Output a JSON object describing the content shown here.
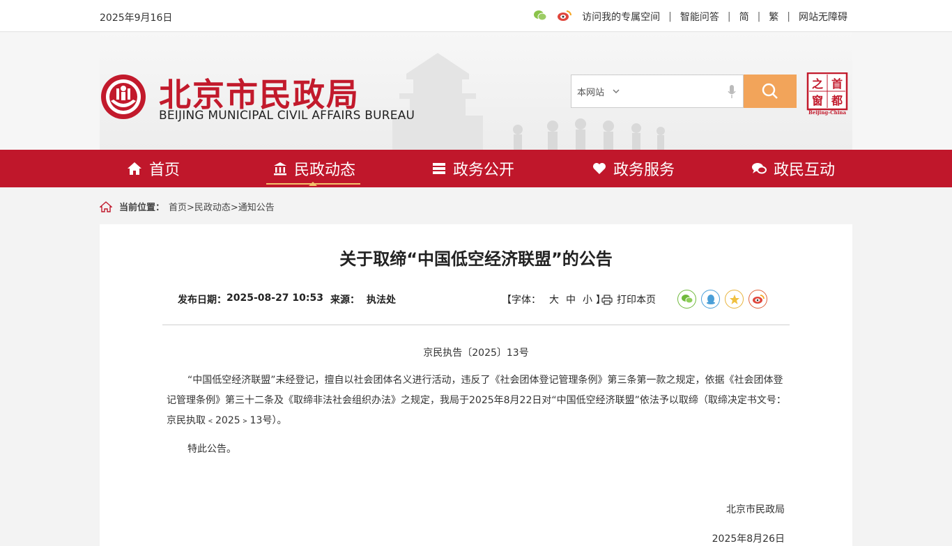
{
  "topbar": {
    "date": "2025年9月16日",
    "links": [
      "访问我的专属空间",
      "智能问答",
      "简",
      "繁",
      "网站无障碍"
    ],
    "icons": [
      "wechat-icon",
      "weibo-icon"
    ]
  },
  "header": {
    "logo_cn": "北京市民政局",
    "logo_en": "BEIJING MUNICIPAL CIVIL AFFAIRS BUREAU",
    "search": {
      "scope": "本网站",
      "placeholder": ""
    },
    "capital_badge": {
      "chars": [
        "首",
        "都",
        "之",
        "窗"
      ],
      "caption": "Beijing-China"
    }
  },
  "nav": {
    "items": [
      {
        "label": "首页",
        "icon": "home-icon"
      },
      {
        "label": "民政动态",
        "icon": "building-icon"
      },
      {
        "label": "政务公开",
        "icon": "list-icon"
      },
      {
        "label": "政务服务",
        "icon": "heart-icon"
      },
      {
        "label": "政民互动",
        "icon": "chat-icon"
      }
    ],
    "active": "民政动态"
  },
  "breadcrumb": {
    "label": "当前位置：",
    "path": "首页>民政动态>通知公告"
  },
  "article": {
    "title": "关于取缔“中国低空经济联盟”的公告",
    "meta": {
      "date_label": "发布日期：",
      "date": "2025-08-27 10:53",
      "source_label": "来源：",
      "source": "执法处"
    },
    "font_size": {
      "open": "【字体：",
      "large": "大",
      "medium": "中",
      "small": "小",
      "close": "】"
    },
    "print": "打印本页",
    "share_icons": [
      "wechat-icon",
      "qq-icon",
      "favorite-icon",
      "weibo-icon"
    ],
    "doc_no": "京民执告〔2025〕13号",
    "paragraph1": "“中国低空经济联盟”未经登记，擅自以社会团体名义进行活动，违反了《社会团体登记管理条例》第三条第一款之规定，依据《社会团体登记管理条例》第三十二条及《取缔非法社会组织办法》之规定，我局于2025年8月22日对“中国低空经济联盟”依法予以取缔（取缔决定书文号：京民执取﹤2025﹥13号）。",
    "paragraph2": "特此公告。",
    "signature": "北京市民政局",
    "signature_date": "2025年8月26日"
  },
  "colors": {
    "brand_red": "#c0172b",
    "search_orange": "#f2a45a",
    "active_gold": "#f2c36b"
  }
}
